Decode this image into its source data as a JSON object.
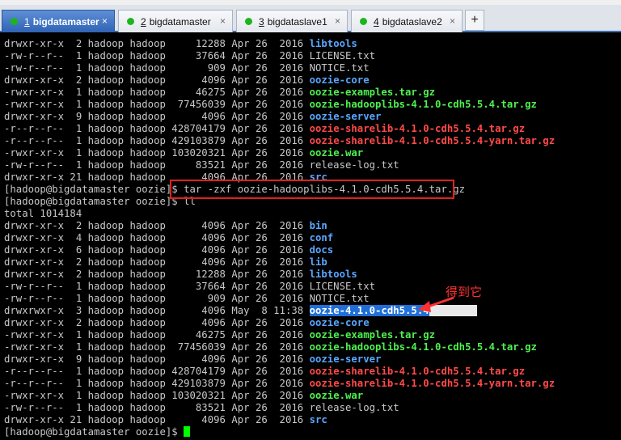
{
  "tabs": [
    {
      "num": "1",
      "label": "bigdatamaster",
      "active": true
    },
    {
      "num": "2",
      "label": "bigdatamaster",
      "active": false
    },
    {
      "num": "3",
      "label": "bigdataslave1",
      "active": false
    },
    {
      "num": "4",
      "label": "bigdataslave2",
      "active": false
    }
  ],
  "tab_close_glyph": "×",
  "add_tab_glyph": "+",
  "annotation": "得到它",
  "colors": {
    "directory": "#5aa7ff",
    "archive": "#ff4a4a",
    "executable": "#4ff04f",
    "highlight": "#1f6fd6",
    "annotation": "#ff3030",
    "cursor": "#00ff00"
  },
  "terminal_lines": [
    [
      [
        "drwxr-xr-x  2 hadoop hadoop     12288 Apr 26  2016 ",
        "t"
      ],
      [
        "libtools",
        "dir"
      ]
    ],
    [
      [
        "-rw-r--r--  1 hadoop hadoop     37664 Apr 26  2016 LICENSE.txt",
        "t"
      ]
    ],
    [
      [
        "-rw-r--r--  1 hadoop hadoop       909 Apr 26  2016 NOTICE.txt",
        "t"
      ]
    ],
    [
      [
        "drwxr-xr-x  2 hadoop hadoop      4096 Apr 26  2016 ",
        "t"
      ],
      [
        "oozie-core",
        "dir"
      ]
    ],
    [
      [
        "-rwxr-xr-x  1 hadoop hadoop     46275 Apr 26  2016 ",
        "t"
      ],
      [
        "oozie-examples.tar.gz",
        "exe"
      ]
    ],
    [
      [
        "-rwxr-xr-x  1 hadoop hadoop  77456039 Apr 26  2016 ",
        "t"
      ],
      [
        "oozie-hadooplibs-4.1.0-cdh5.5.4.tar.gz",
        "exe"
      ]
    ],
    [
      [
        "drwxr-xr-x  9 hadoop hadoop      4096 Apr 26  2016 ",
        "t"
      ],
      [
        "oozie-server",
        "dir"
      ]
    ],
    [
      [
        "-r--r--r--  1 hadoop hadoop 428704179 Apr 26  2016 ",
        "t"
      ],
      [
        "oozie-sharelib-4.1.0-cdh5.5.4.tar.gz",
        "arc"
      ]
    ],
    [
      [
        "-r--r--r--  1 hadoop hadoop 429103879 Apr 26  2016 ",
        "t"
      ],
      [
        "oozie-sharelib-4.1.0-cdh5.5.4-yarn.tar.gz",
        "arc"
      ]
    ],
    [
      [
        "-rwxr-xr-x  1 hadoop hadoop 103020321 Apr 26  2016 ",
        "t"
      ],
      [
        "oozie.war",
        "exe"
      ]
    ],
    [
      [
        "-rw-r--r--  1 hadoop hadoop     83521 Apr 26  2016 release-log.txt",
        "t"
      ]
    ],
    [
      [
        "drwxr-xr-x 21 hadoop hadoop      4096 Apr 26  2016 ",
        "t"
      ],
      [
        "src",
        "dir"
      ]
    ],
    [
      [
        "[hadoop@bigdatamaster oozie]$ tar -zxf oozie-hadooplibs-4.1.0-cdh5.5.4.tar.gz",
        "t"
      ]
    ],
    [
      [
        "[hadoop@bigdatamaster oozie]$ ll",
        "t"
      ]
    ],
    [
      [
        "total 1014184",
        "t"
      ]
    ],
    [
      [
        "drwxr-xr-x  2 hadoop hadoop      4096 Apr 26  2016 ",
        "t"
      ],
      [
        "bin",
        "dir"
      ]
    ],
    [
      [
        "drwxr-xr-x  4 hadoop hadoop      4096 Apr 26  2016 ",
        "t"
      ],
      [
        "conf",
        "dir"
      ]
    ],
    [
      [
        "drwxr-xr-x  6 hadoop hadoop      4096 Apr 26  2016 ",
        "t"
      ],
      [
        "docs",
        "dir"
      ]
    ],
    [
      [
        "drwxr-xr-x  2 hadoop hadoop      4096 Apr 26  2016 ",
        "t"
      ],
      [
        "lib",
        "dir"
      ]
    ],
    [
      [
        "drwxr-xr-x  2 hadoop hadoop     12288 Apr 26  2016 ",
        "t"
      ],
      [
        "libtools",
        "dir"
      ]
    ],
    [
      [
        "-rw-r--r--  1 hadoop hadoop     37664 Apr 26  2016 LICENSE.txt",
        "t"
      ]
    ],
    [
      [
        "-rw-r--r--  1 hadoop hadoop       909 Apr 26  2016 NOTICE.txt",
        "t"
      ]
    ],
    [
      [
        "drwxrwxr-x  3 hadoop hadoop      4096 May  8 11:38 ",
        "t"
      ],
      [
        "oozie-4.1.0-cdh5.5.4",
        "hl"
      ],
      [
        "        ",
        "hlrest"
      ]
    ],
    [
      [
        "drwxr-xr-x  2 hadoop hadoop      4096 Apr 26  2016 ",
        "t"
      ],
      [
        "oozie-core",
        "dir"
      ]
    ],
    [
      [
        "-rwxr-xr-x  1 hadoop hadoop     46275 Apr 26  2016 ",
        "t"
      ],
      [
        "oozie-examples.tar.gz",
        "exe"
      ]
    ],
    [
      [
        "-rwxr-xr-x  1 hadoop hadoop  77456039 Apr 26  2016 ",
        "t"
      ],
      [
        "oozie-hadooplibs-4.1.0-cdh5.5.4.tar.gz",
        "exe"
      ]
    ],
    [
      [
        "drwxr-xr-x  9 hadoop hadoop      4096 Apr 26  2016 ",
        "t"
      ],
      [
        "oozie-server",
        "dir"
      ]
    ],
    [
      [
        "-r--r--r--  1 hadoop hadoop 428704179 Apr 26  2016 ",
        "t"
      ],
      [
        "oozie-sharelib-4.1.0-cdh5.5.4.tar.gz",
        "arc"
      ]
    ],
    [
      [
        "-r--r--r--  1 hadoop hadoop 429103879 Apr 26  2016 ",
        "t"
      ],
      [
        "oozie-sharelib-4.1.0-cdh5.5.4-yarn.tar.gz",
        "arc"
      ]
    ],
    [
      [
        "-rwxr-xr-x  1 hadoop hadoop 103020321 Apr 26  2016 ",
        "t"
      ],
      [
        "oozie.war",
        "exe"
      ]
    ],
    [
      [
        "-rw-r--r--  1 hadoop hadoop     83521 Apr 26  2016 release-log.txt",
        "t"
      ]
    ],
    [
      [
        "drwxr-xr-x 21 hadoop hadoop      4096 Apr 26  2016 ",
        "t"
      ],
      [
        "src",
        "dir"
      ]
    ],
    [
      [
        "[hadoop@bigdatamaster oozie]$ ",
        "t"
      ],
      [
        "",
        "cursor"
      ]
    ]
  ]
}
